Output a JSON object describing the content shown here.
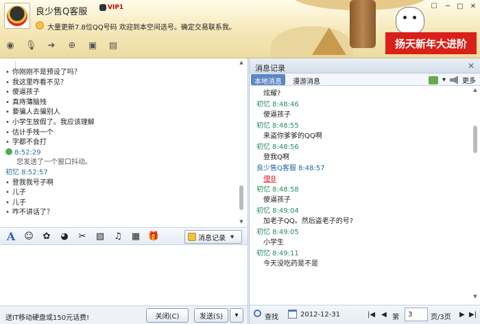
{
  "header": {
    "contact_name": "良少售Q客服",
    "vip_badge": "VIP1",
    "signature": "大量更新7.8位QQ号码  欢迎到本空间选号。确定交易联系我。",
    "banner_text": "扬天新年大进阶"
  },
  "chat": {
    "lines_a": [
      "你刚刚不是预设了吗？",
      "我这里咋看不见？",
      "傻逼孩子",
      "真痔薄脑残",
      "要骗人去骗别人",
      "小学生放假了。我应该理解",
      "估计手残一个",
      "字都不会打"
    ],
    "status_time": "8:52:29",
    "status_text": "您发送了一个窗口抖动。",
    "sender_line": "初忆  8:52:57",
    "lines_b": [
      "登我我号子啊",
      "儿子",
      "儿子",
      "咋不讲话了？"
    ]
  },
  "format_toolbar": {
    "font_label": "A",
    "history_button": "消息记录"
  },
  "bottom": {
    "ad_text": "送IT移动硬盘或150元话费!",
    "close_button": "关闭(C)",
    "send_button": "发送(S)"
  },
  "history": {
    "title": "消息记录",
    "tab_local": "本地消息",
    "tab_roam": "漫游消息",
    "more_label": "更多",
    "entries": [
      {
        "type": "msg",
        "text": "炫耀?"
      },
      {
        "type": "meta",
        "text": "初忆  8:48:46"
      },
      {
        "type": "msg",
        "text": "傻逼孩子"
      },
      {
        "type": "meta",
        "text": "初忆  8:48:55"
      },
      {
        "type": "msg",
        "text": "来盗你爹爹的QQ啊"
      },
      {
        "type": "meta",
        "text": "初忆  8:48:56"
      },
      {
        "type": "msg",
        "text": "登我Q啊"
      },
      {
        "type": "meta-blue",
        "text": "良少售Q客服  8:48:57"
      },
      {
        "type": "msg-red",
        "text": "傻B"
      },
      {
        "type": "meta",
        "text": "初忆  8:48:58"
      },
      {
        "type": "msg",
        "text": "傻逼孩子"
      },
      {
        "type": "meta",
        "text": "初忆  8:49:04"
      },
      {
        "type": "msg",
        "text": "加老子QQ。然后盗老子的号?"
      },
      {
        "type": "meta",
        "text": "初忆  8:49:05"
      },
      {
        "type": "msg",
        "text": "小学生"
      },
      {
        "type": "meta",
        "text": "初忆  8:49:11"
      },
      {
        "type": "msg",
        "text": "今天没吃药是不是"
      }
    ],
    "find_label": "查找",
    "date": "2012-12-31",
    "page_prefix": "第",
    "page_value": "3",
    "page_suffix": "页/3页"
  }
}
